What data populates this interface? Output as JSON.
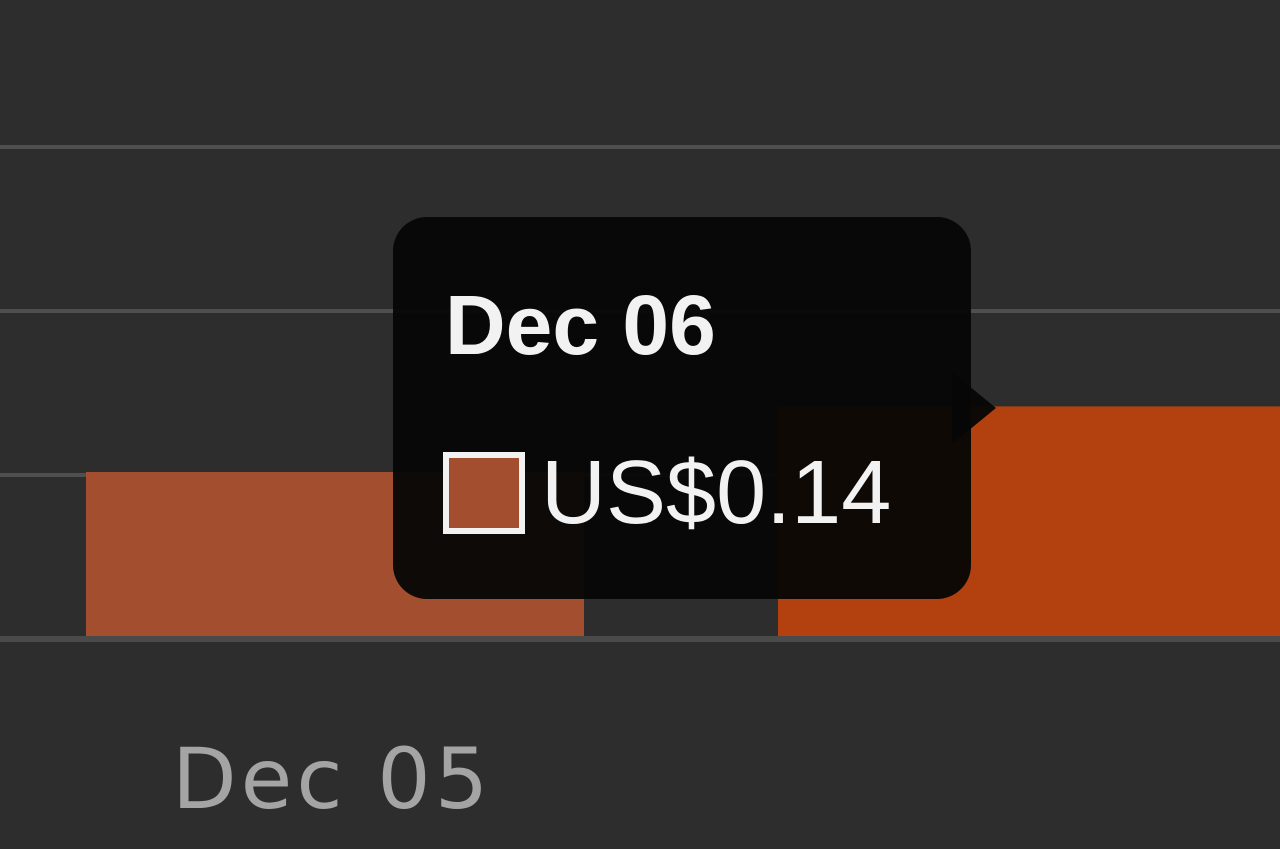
{
  "chart_data": {
    "type": "bar",
    "categories": [
      "Dec 05",
      "Dec 06"
    ],
    "series": [
      {
        "values": [
          0.1,
          0.14
        ]
      }
    ],
    "colors": [
      "#a34f2f",
      "#b3410f"
    ],
    "grid": true,
    "tooltip": {
      "title": "Dec 06",
      "value_text": "US$0.14",
      "swatch_color": "#a34f2f"
    }
  }
}
